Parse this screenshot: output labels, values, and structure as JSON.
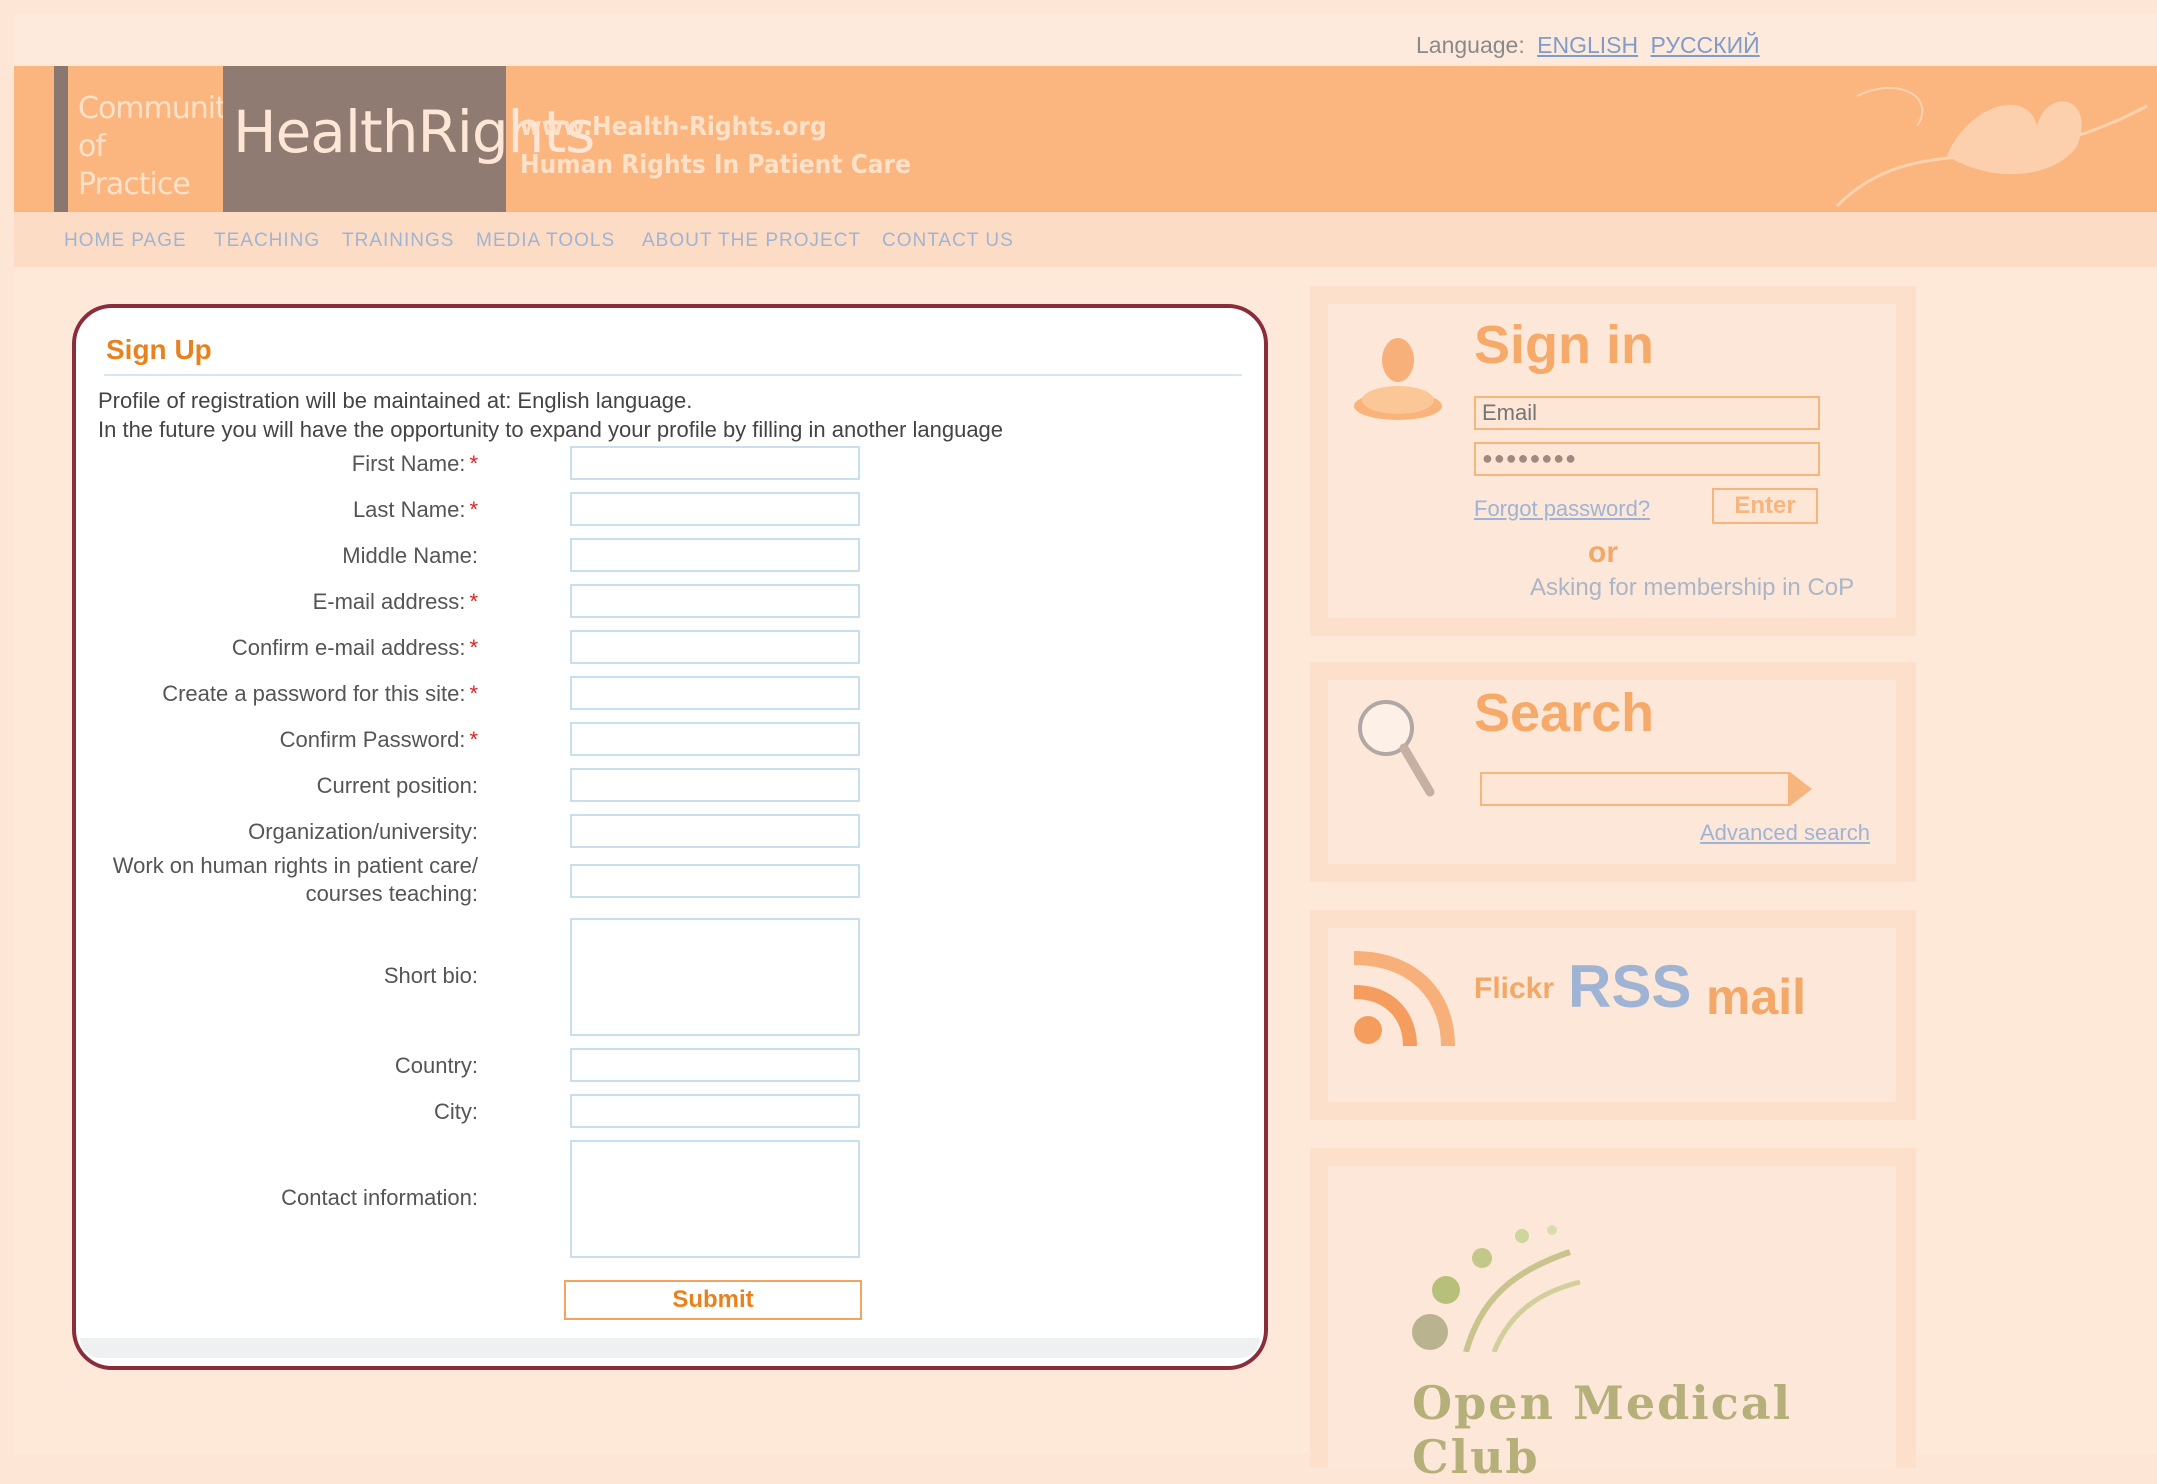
{
  "header": {
    "language_label": "Language:",
    "languages": [
      "ENGLISH",
      "РУССКИЙ"
    ],
    "logo_left": [
      "Community",
      "of Practice"
    ],
    "logo_main": "HealthRights",
    "site_url": "www.Health-Rights.org",
    "tagline": "Human Rights In Patient Care"
  },
  "nav": {
    "items": [
      "HOME PAGE",
      "TEACHING",
      "TRAININGS",
      "MEDIA TOOLS",
      "ABOUT THE PROJECT",
      "CONTACT US"
    ]
  },
  "signup": {
    "title": "Sign Up",
    "intro_1": "Profile of registration will be maintained at: English language.",
    "intro_2": "In the future you will have the opportunity to expand your profile by filling in another language",
    "fields": [
      {
        "label": "First Name:",
        "required": true
      },
      {
        "label": "Last Name:",
        "required": true
      },
      {
        "label": "Middle Name:",
        "required": false
      },
      {
        "label": "E-mail address:",
        "required": true
      },
      {
        "label": "Confirm e-mail address:",
        "required": true
      },
      {
        "label": "Create a password for this site:",
        "required": true
      },
      {
        "label": "Confirm Password:",
        "required": true
      },
      {
        "label": "Current position:",
        "required": false
      },
      {
        "label": "Organization/university:",
        "required": false
      },
      {
        "label": "Work on human rights in patient care/",
        "label_2": "courses teaching:",
        "required": false
      },
      {
        "label": "Short bio:",
        "required": false
      },
      {
        "label": "Country:",
        "required": false
      },
      {
        "label": "City:",
        "required": false
      },
      {
        "label": "Contact information:",
        "required": false
      }
    ],
    "required_mark": "*",
    "submit_label": "Submit"
  },
  "signin": {
    "title": "Sign in",
    "email_placeholder": "Email",
    "password_value": "●●●●●●●●",
    "forgot_label": "Forgot password?",
    "enter_label": "Enter",
    "or_label": "or",
    "membership_label": "Asking for membership in CoP"
  },
  "search": {
    "title": "Search",
    "advanced_label": "Advanced search"
  },
  "social": {
    "flickr": "Flickr",
    "rss": "RSS",
    "mail": "mail"
  },
  "club": {
    "name": "Open Medical Club"
  },
  "colors": {
    "accent_orange": "#e8821e",
    "banner": "#fbb57f",
    "frame": "#8a2c3a",
    "link_blue": "#9fb4d4"
  }
}
